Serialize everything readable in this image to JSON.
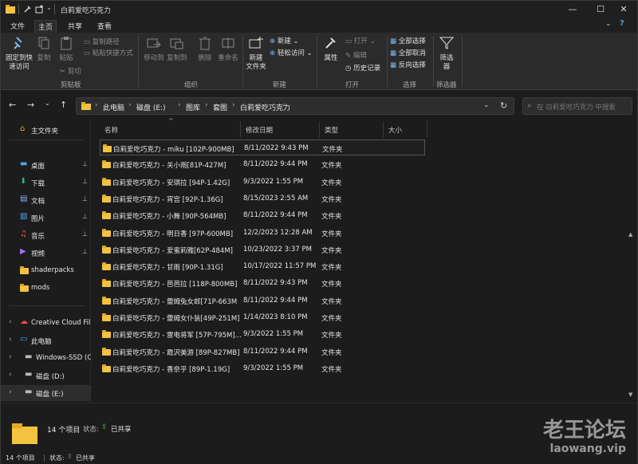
{
  "window": {
    "title": "白莉爱吃巧克力",
    "min": "—",
    "max": "☐",
    "close": "✕"
  },
  "tabs": [
    "文件",
    "主页",
    "共享",
    "查看"
  ],
  "ribbon": {
    "pin_quick": "固定到快\n速访问",
    "copy": "复制",
    "paste": "粘贴",
    "copy_path": "复制路径",
    "paste_shortcut": "粘贴快捷方式",
    "cut": "剪切",
    "move_to": "移动到",
    "copy_to": "复制到",
    "delete": "删除",
    "rename": "重命名",
    "new_folder": "新建\n文件夹",
    "new_item": "新建",
    "easy_access": "轻松访问",
    "properties": "属性",
    "open": "打开",
    "edit": "编辑",
    "history": "历史记录",
    "select_all": "全部选择",
    "select_none": "全部取消",
    "invert": "反向选择",
    "filter": "筛选\n器",
    "groups": [
      "剪贴板",
      "组织",
      "新建",
      "打开",
      "选择",
      "筛选器"
    ]
  },
  "nav": {
    "crumbs": [
      "此电脑",
      "磁盘 (E:)",
      "图库",
      "套图",
      "白莉爱吃巧克力"
    ],
    "search_placeholder": "在 白莉爱吃巧克力 中搜索"
  },
  "sidebar": [
    {
      "label": "主文件夹",
      "icon": "home-icon"
    },
    {
      "label": "桌面",
      "icon": "desktop-icon",
      "pin": true
    },
    {
      "label": "下载",
      "icon": "download-icon",
      "pin": true
    },
    {
      "label": "文档",
      "icon": "document-icon",
      "pin": true
    },
    {
      "label": "图片",
      "icon": "pictures-icon",
      "pin": true
    },
    {
      "label": "音乐",
      "icon": "music-icon",
      "pin": true
    },
    {
      "label": "视频",
      "icon": "video-icon",
      "pin": true
    },
    {
      "label": "shaderpacks",
      "icon": "folder-icon"
    },
    {
      "label": "mods",
      "icon": "folder-icon"
    },
    {
      "label": "Creative Cloud Files",
      "icon": "cloud-icon"
    },
    {
      "label": "此电脑",
      "icon": "computer-icon"
    },
    {
      "label": "Windows-SSD (C:)",
      "icon": "drive-icon"
    },
    {
      "label": "磁盘 (D:)",
      "icon": "drive-icon"
    },
    {
      "label": "磁盘 (E:)",
      "icon": "drive-icon"
    }
  ],
  "columns": [
    "名称",
    "修改日期",
    "类型",
    "大小"
  ],
  "files": [
    {
      "name": "白莉爱吃巧克力 - miku [102P-900MB]",
      "date": "8/11/2022 9:43 PM",
      "type": "文件夹"
    },
    {
      "name": "白莉爱吃巧克力 - 关小雨[81P-427M]",
      "date": "8/11/2022 9:44 PM",
      "type": "文件夹"
    },
    {
      "name": "白莉爱吃巧克力 - 安琪拉 [94P-1.42G]",
      "date": "9/3/2022 1:55 PM",
      "type": "文件夹"
    },
    {
      "name": "白莉爱吃巧克力 - 宵宫 [92P-1.36G]",
      "date": "8/15/2023 2:55 AM",
      "type": "文件夹"
    },
    {
      "name": "白莉爱吃巧克力 - 小舞 [90P-564MB]",
      "date": "8/11/2022 9:44 PM",
      "type": "文件夹"
    },
    {
      "name": "白莉爱吃巧克力 - 明日香 [97P-600MB]",
      "date": "12/2/2023 12:28 AM",
      "type": "文件夹"
    },
    {
      "name": "白莉爱吃巧克力 - 爱蜜莉雅[62P-484M]",
      "date": "10/23/2022 3:37 PM",
      "type": "文件夹"
    },
    {
      "name": "白莉爱吃巧克力 - 甘雨 [90P-1.31G]",
      "date": "10/17/2022 11:57 PM",
      "type": "文件夹"
    },
    {
      "name": "白莉爱吃巧克力 - 芭芭拉 [118P-800MB]",
      "date": "8/11/2022 9:43 PM",
      "type": "文件夹"
    },
    {
      "name": "白莉爱吃巧克力 - 蕾姆兔女郎[71P-663M",
      "date": "8/11/2022 9:44 PM",
      "type": "文件夹"
    },
    {
      "name": "白莉爱吃巧克力 - 蕾姆女仆装[49P-251M]",
      "date": "1/14/2023 8:10 PM",
      "type": "文件夹"
    },
    {
      "name": "白莉爱吃巧克力 - 雷电将军 [57P-795M]...",
      "date": "9/3/2022 1:55 PM",
      "type": "文件夹"
    },
    {
      "name": "白莉爱吃巧克力 - 霞沢美游 [89P-827MB]",
      "date": "8/11/2022 9:44 PM",
      "type": "文件夹"
    },
    {
      "name": "白莉爱吃巧克力 - 香奈乎 [89P-1.19G]",
      "date": "9/3/2022 1:55 PM",
      "type": "文件夹"
    }
  ],
  "details": {
    "count": "14 个项目",
    "state_label": "状态:",
    "shared": "已共享"
  },
  "status": {
    "count": "14 个项目",
    "state_label": "状态:",
    "shared": "已共享"
  },
  "watermark": {
    "line1": "老王论坛",
    "line2": "laowang.vip"
  }
}
